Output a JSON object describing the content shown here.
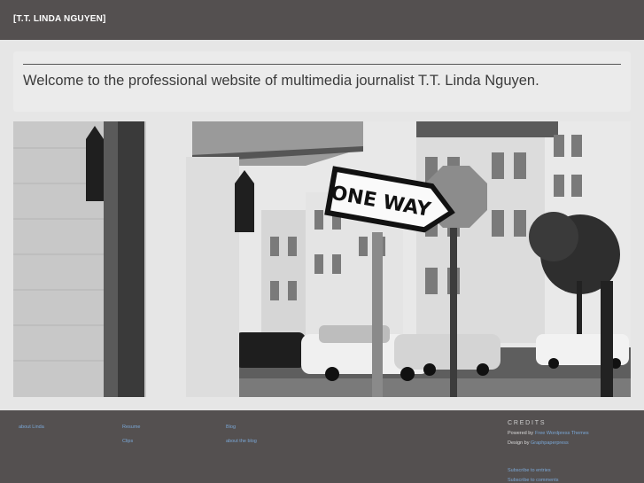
{
  "header": {
    "site_title": "[T.T. LINDA NGUYEN]"
  },
  "welcome": {
    "text": "Welcome to the professional website of multimedia journalist T.T. Linda Nguyen."
  },
  "photo": {
    "sign_text": "ONE WAY"
  },
  "footer": {
    "col1": {
      "links": [
        "about Linda"
      ]
    },
    "col2": {
      "links": [
        "Resume",
        "Clips"
      ]
    },
    "col3": {
      "links": [
        "Blog",
        "about the blog"
      ]
    },
    "credits": {
      "heading": "CREDITS",
      "powered_prefix": "Powered by",
      "powered_link": "Free Wordpress Themes",
      "design_prefix": "Design by",
      "design_link": "Graphpaperpress",
      "subscribe_entries": "Subscribe to entries",
      "subscribe_comments": "Subscribe to comments"
    }
  },
  "colors": {
    "header_bg": "#545050",
    "footer_bg": "#545050",
    "link": "#7aa7d6",
    "page_bg": "#e6e6e6"
  }
}
